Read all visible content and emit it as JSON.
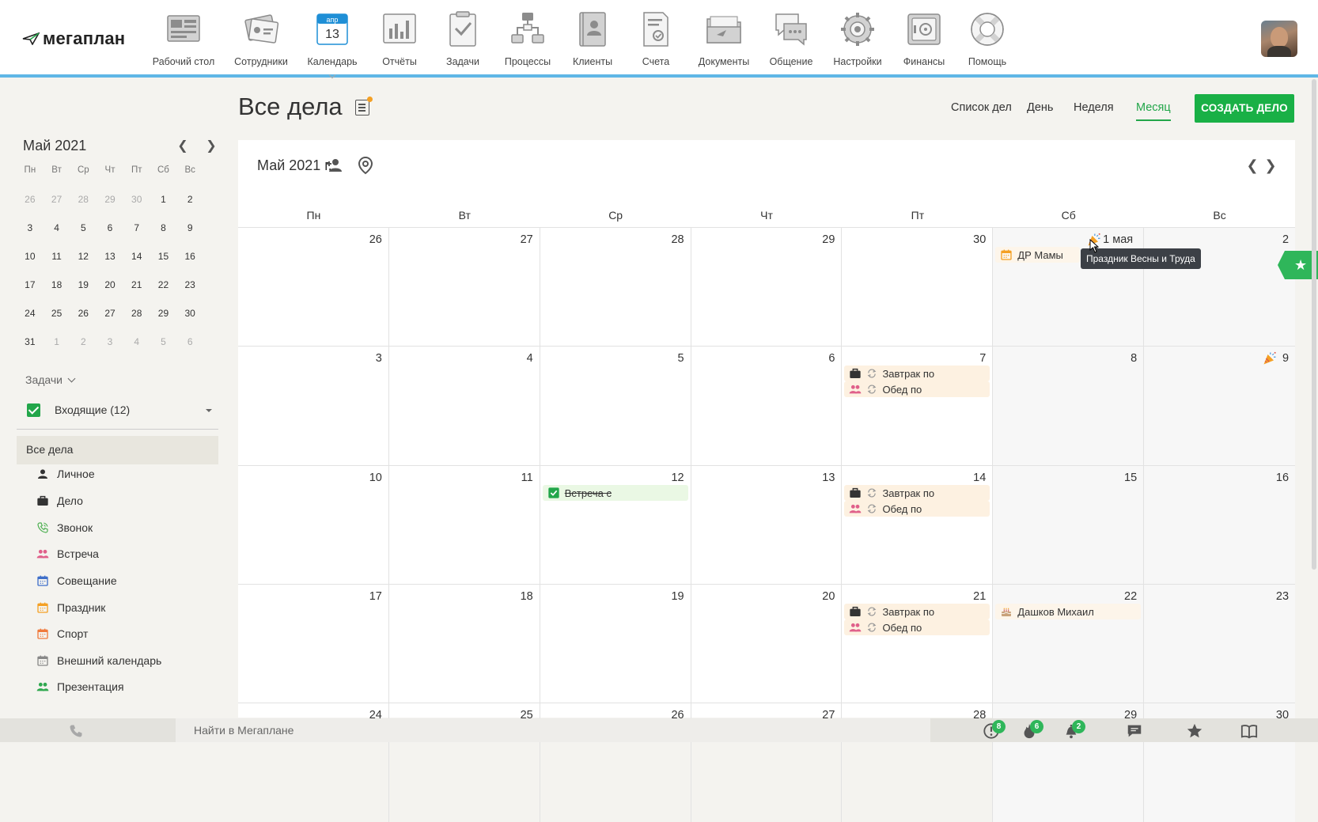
{
  "app": {
    "logo_text": "мегаплан"
  },
  "nav": [
    {
      "label": "Рабочий стол",
      "icon": "dashboard-icon"
    },
    {
      "label": "Сотрудники",
      "icon": "employees-icon"
    },
    {
      "label": "Календарь",
      "icon": "calendar-icon",
      "badge_month": "апр",
      "badge_day": "13",
      "active": true
    },
    {
      "label": "Отчёты",
      "icon": "reports-icon"
    },
    {
      "label": "Задачи",
      "icon": "tasks-icon"
    },
    {
      "label": "Процессы",
      "icon": "processes-icon"
    },
    {
      "label": "Клиенты",
      "icon": "clients-icon"
    },
    {
      "label": "Счета",
      "icon": "invoices-icon"
    },
    {
      "label": "Документы",
      "icon": "documents-icon"
    },
    {
      "label": "Общение",
      "icon": "chat-icon"
    },
    {
      "label": "Настройки",
      "icon": "settings-icon"
    },
    {
      "label": "Финансы",
      "icon": "finance-icon"
    },
    {
      "label": "Помощь",
      "icon": "help-icon"
    }
  ],
  "mini_calendar": {
    "title": "Май 2021",
    "weekdays": [
      "Пн",
      "Вт",
      "Ср",
      "Чт",
      "Пт",
      "Сб",
      "Вс"
    ],
    "today_weekday_index": 1,
    "weeks": [
      [
        [
          "26",
          true
        ],
        [
          "27",
          true
        ],
        [
          "28",
          true
        ],
        [
          "29",
          true
        ],
        [
          "30",
          true
        ],
        [
          "1",
          false
        ],
        [
          "2",
          false
        ]
      ],
      [
        [
          "3",
          false
        ],
        [
          "4",
          false
        ],
        [
          "5",
          false
        ],
        [
          "6",
          false
        ],
        [
          "7",
          false
        ],
        [
          "8",
          false
        ],
        [
          "9",
          false
        ]
      ],
      [
        [
          "10",
          false
        ],
        [
          "11",
          false
        ],
        [
          "12",
          false
        ],
        [
          "13",
          false
        ],
        [
          "14",
          false
        ],
        [
          "15",
          false
        ],
        [
          "16",
          false
        ]
      ],
      [
        [
          "17",
          false
        ],
        [
          "18",
          false
        ],
        [
          "19",
          false
        ],
        [
          "20",
          false
        ],
        [
          "21",
          false
        ],
        [
          "22",
          false
        ],
        [
          "23",
          false
        ]
      ],
      [
        [
          "24",
          false
        ],
        [
          "25",
          false
        ],
        [
          "26",
          false
        ],
        [
          "27",
          false
        ],
        [
          "28",
          false
        ],
        [
          "29",
          false
        ],
        [
          "30",
          false
        ]
      ],
      [
        [
          "31",
          false
        ],
        [
          "1",
          true
        ],
        [
          "2",
          true
        ],
        [
          "3",
          true
        ],
        [
          "4",
          true
        ],
        [
          "5",
          true
        ],
        [
          "6",
          true
        ]
      ]
    ]
  },
  "sidebar": {
    "tasks_header": "Задачи",
    "inbox_label": "Входящие (12)",
    "all_deals": "Все дела",
    "categories": [
      {
        "label": "Личное",
        "icon": "person-icon",
        "color": "#333333"
      },
      {
        "label": "Дело",
        "icon": "briefcase-icon",
        "color": "#333333"
      },
      {
        "label": "Звонок",
        "icon": "phone-icon",
        "color": "#4caf50"
      },
      {
        "label": "Встреча",
        "icon": "people-icon",
        "color": "#e0608a"
      },
      {
        "label": "Совещание",
        "icon": "calendar-icon",
        "color": "#3f6fc9"
      },
      {
        "label": "Праздник",
        "icon": "calendar-icon",
        "color": "#f4a024"
      },
      {
        "label": "Спорт",
        "icon": "calendar-icon",
        "color": "#f07a3c"
      },
      {
        "label": "Внешний календарь",
        "icon": "calendar-icon",
        "color": "#888888"
      },
      {
        "label": "Презентация",
        "icon": "people-icon",
        "color": "#2fa84f"
      }
    ]
  },
  "header": {
    "title": "Все дела",
    "views": [
      "Список дел",
      "День",
      "Неделя",
      "Месяц"
    ],
    "active_view": "Месяц",
    "create_button": "СОЗДАТЬ ДЕЛО"
  },
  "calendar": {
    "month_title": "Май 2021 г.",
    "weekdays": [
      "Пн",
      "Вт",
      "Ср",
      "Чт",
      "Пт",
      "Сб",
      "Вс"
    ],
    "weeks": [
      [
        "26",
        "27",
        "28",
        "29",
        "30",
        "1 мая",
        "2"
      ],
      [
        "3",
        "4",
        "5",
        "6",
        "7",
        "8",
        "9"
      ],
      [
        "10",
        "11",
        "12",
        "13",
        "14",
        "15",
        "16"
      ],
      [
        "17",
        "18",
        "19",
        "20",
        "21",
        "22",
        "23"
      ],
      [
        "24",
        "25",
        "26",
        "27",
        "28",
        "29",
        "30"
      ]
    ],
    "holidays": [
      {
        "week": 0,
        "day": 5
      },
      {
        "week": 1,
        "day": 6
      }
    ],
    "events": [
      {
        "week": 0,
        "day": 5,
        "slot": 0,
        "text": "ДР Мамы",
        "icon": "calendar-icon",
        "icon_color": "#f4a024",
        "style": "plain",
        "repeat": false
      },
      {
        "week": 1,
        "day": 4,
        "slot": 0,
        "text": "Завтрак по",
        "icon": "briefcase-icon",
        "icon_color": "#333333",
        "style": "orange",
        "repeat": true
      },
      {
        "week": 1,
        "day": 4,
        "slot": 1,
        "text": "Обед по",
        "icon": "people-icon",
        "icon_color": "#e0608a",
        "style": "orange",
        "repeat": true
      },
      {
        "week": 2,
        "day": 2,
        "slot": 0,
        "text": "Встреча с",
        "icon": "checkbox-icon",
        "icon_color": "#22a64a",
        "style": "green",
        "repeat": false,
        "done": true
      },
      {
        "week": 2,
        "day": 4,
        "slot": 0,
        "text": "Завтрак по",
        "icon": "briefcase-icon",
        "icon_color": "#333333",
        "style": "orange",
        "repeat": true
      },
      {
        "week": 2,
        "day": 4,
        "slot": 1,
        "text": "Обед по",
        "icon": "people-icon",
        "icon_color": "#e0608a",
        "style": "orange",
        "repeat": true
      },
      {
        "week": 3,
        "day": 4,
        "slot": 0,
        "text": "Завтрак по",
        "icon": "briefcase-icon",
        "icon_color": "#333333",
        "style": "orange",
        "repeat": true
      },
      {
        "week": 3,
        "day": 4,
        "slot": 1,
        "text": "Обед по",
        "icon": "people-icon",
        "icon_color": "#e0608a",
        "style": "orange",
        "repeat": true
      },
      {
        "week": 3,
        "day": 5,
        "slot": 0,
        "text": "Дашков Михаил",
        "icon": "cake-icon",
        "icon_color": "#c9a27a",
        "style": "plain",
        "repeat": false
      }
    ],
    "tooltip": "Праздник Весны и Труда"
  },
  "bottombar": {
    "search_placeholder": "Найти в Мегаплане",
    "icons": [
      {
        "name": "alert-icon",
        "badge": "8"
      },
      {
        "name": "fire-icon",
        "badge": "6"
      },
      {
        "name": "bell-icon",
        "badge": "2"
      },
      {
        "name": "messages-icon",
        "badge": ""
      },
      {
        "name": "star-icon",
        "badge": ""
      },
      {
        "name": "book-icon",
        "badge": ""
      }
    ]
  },
  "colors": {
    "accent": "#22a64a",
    "top_border": "#5fb6e6",
    "page_bg": "#f4f3ef"
  }
}
